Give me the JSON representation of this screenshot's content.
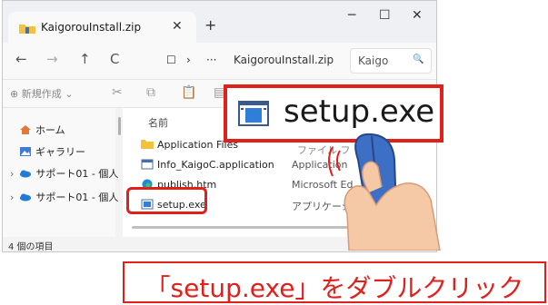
{
  "tab": {
    "title": "KaigorouInstall.zip",
    "close": "✕",
    "new": "+"
  },
  "window_controls": {
    "minimize": "─",
    "maximize": "☐",
    "close": "✕"
  },
  "nav": {
    "back": "←",
    "forward": "→",
    "up": "↑",
    "refresh": "C",
    "monitor": "☐",
    "chevron": "›",
    "more": "···",
    "path": "KaigorouInstall.zip"
  },
  "search": {
    "text": "Kaigo",
    "icon": "🔍"
  },
  "toolbar": {
    "new_label": "⊕ 新規作成 ⌄",
    "cut": "✂",
    "copy": "⧉",
    "paste": "📋",
    "rename": "▤"
  },
  "sidebar": {
    "items": [
      {
        "label": "ホーム",
        "icon": "home-icon"
      },
      {
        "label": "ギャラリー",
        "icon": "gallery-icon"
      },
      {
        "label": "サポート01 - 個人",
        "icon": "onedrive-icon"
      },
      {
        "label": "サポート01 - 個人",
        "icon": "onedrive-icon"
      }
    ]
  },
  "content": {
    "column_name": "名前",
    "column_type_partial": "ファイル フ",
    "files": [
      {
        "name": "Application Files",
        "type": "ファイル フ",
        "icon": "folder-icon"
      },
      {
        "name": "Info_KaigoC.application",
        "type": "Application",
        "icon": "application-icon"
      },
      {
        "name": "publish.htm",
        "type": "Microsoft Ed",
        "icon": "edge-icon"
      },
      {
        "name": "setup.exe",
        "type": "アプリケーション",
        "icon": "exe-icon"
      }
    ]
  },
  "status": {
    "count": "4 個の項目"
  },
  "zoom": {
    "label": "setup.exe"
  },
  "caption": {
    "text": "「setup.exe」をダブルクリック"
  },
  "colors": {
    "accent_red": "#e0201b",
    "folder_yellow": "#f2c23c",
    "hand_blue": "#3d6fc4",
    "skin": "#f5c9a5"
  }
}
